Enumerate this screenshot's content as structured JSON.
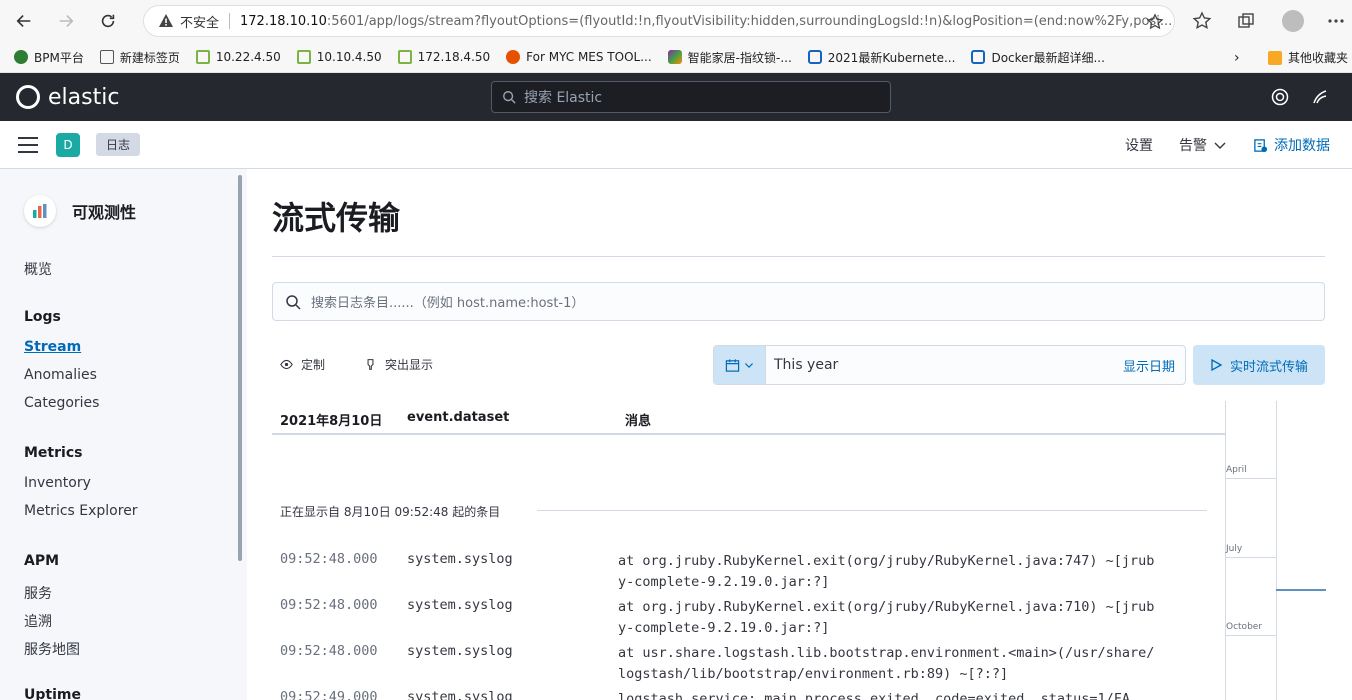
{
  "browser": {
    "insecure_label": "不安全",
    "url_host": "172.18.10.10",
    "url_path": ":5601/app/logs/stream?flyoutOptions=(flyoutId:!n,flyoutVisibility:hidden,surroundingLogsId:!n)&logPosition=(end:now%2Fy,posi...",
    "bookmarks": [
      {
        "label": "BPM平台",
        "color": "#2e7d32"
      },
      {
        "label": "新建标签页",
        "color": "#555555"
      },
      {
        "label": "10.22.4.50",
        "color": "#7cb342"
      },
      {
        "label": "10.10.4.50",
        "color": "#7cb342"
      },
      {
        "label": "172.18.4.50",
        "color": "#7cb342"
      },
      {
        "label": "For MYC MES TOOL...",
        "color": "#e65100"
      },
      {
        "label": "智能家居-指纹锁-...",
        "color": "#8e24aa"
      },
      {
        "label": "2021最新Kubernete...",
        "color": "#1565c0"
      },
      {
        "label": "Docker最新超详细...",
        "color": "#1565c0"
      }
    ],
    "other_bookmarks": "其他收藏夹"
  },
  "header": {
    "brand": "elastic",
    "search_placeholder": "搜索 Elastic"
  },
  "subheader": {
    "space_initial": "D",
    "breadcrumb": "日志",
    "settings": "设置",
    "alerts": "告警",
    "add_data": "添加数据"
  },
  "sidenav": {
    "title": "可观测性",
    "overview": "概览",
    "logs_group": "Logs",
    "stream": "Stream",
    "anomalies": "Anomalies",
    "categories": "Categories",
    "metrics_group": "Metrics",
    "inventory": "Inventory",
    "metrics_explorer": "Metrics Explorer",
    "apm_group": "APM",
    "services": "服务",
    "traces": "追溯",
    "service_map": "服务地图",
    "uptime_group": "Uptime"
  },
  "main": {
    "title": "流式传输",
    "search_placeholder": "搜索日志条目......（例如 host.name:host-1）",
    "customize": "定制",
    "highlight": "突出显示",
    "date_range": "This year",
    "show_dates": "显示日期",
    "live_stream": "实时流式传输",
    "columns": {
      "date": "2021年8月10日",
      "dataset": "event.dataset",
      "message": "消息"
    },
    "showing_from": "正在显示自 8月10日 09:52:48 起的条目",
    "rows": [
      {
        "ts": "09:52:48.000",
        "dataset": "system.syslog",
        "message": "at org.jruby.RubyKernel.exit(org/jruby/RubyKernel.java:747) ~[jruby-complete-9.2.19.0.jar:?]"
      },
      {
        "ts": "09:52:48.000",
        "dataset": "system.syslog",
        "message": "at org.jruby.RubyKernel.exit(org/jruby/RubyKernel.java:710) ~[jruby-complete-9.2.19.0.jar:?]"
      },
      {
        "ts": "09:52:48.000",
        "dataset": "system.syslog",
        "message": "at usr.share.logstash.lib.bootstrap.environment.<main>(/usr/share/logstash/lib/bootstrap/environment.rb:89) ~[?:?]"
      },
      {
        "ts": "09:52:49.000",
        "dataset": "system.syslog",
        "message": "logstash.service: main process exited, code=exited, status=1/FA"
      }
    ],
    "minimap": {
      "april": "April",
      "july": "July",
      "october": "October"
    }
  }
}
